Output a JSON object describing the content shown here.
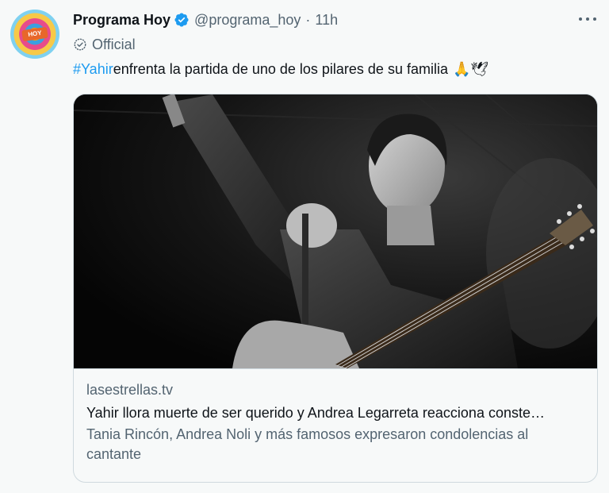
{
  "author": {
    "name": "Programa Hoy",
    "handle": "@programa_hoy",
    "separator": "·",
    "time": "11h",
    "label": "Official",
    "avatar_text": "HOY"
  },
  "tweet": {
    "hashtag": "#Yahir",
    "text": " enfrenta la partida de uno de los pilares de su familia",
    "emojis": "🙏🕊"
  },
  "card": {
    "domain": "lasestrellas.tv",
    "title": "Yahir llora muerte de ser querido y Andrea Legarreta reacciona conste…",
    "description": "Tania Rincón, Andrea Noli y más famosos expresaron condolencias al cantante"
  },
  "colors": {
    "accent": "#1d9bf0",
    "text_primary": "#0f1419",
    "text_secondary": "#536471",
    "border": "#cfd9de",
    "background": "#f7f9f9"
  },
  "icons": {
    "verified": "verified-badge-icon",
    "more": "more-options-icon",
    "official": "official-check-icon"
  }
}
